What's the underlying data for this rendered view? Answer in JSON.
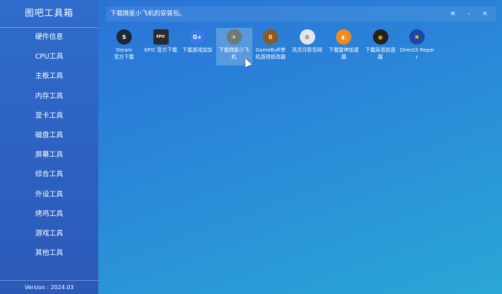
{
  "sidebar": {
    "title": "图吧工具箱",
    "items": [
      {
        "label": "硬件信息"
      },
      {
        "label": "CPU工具"
      },
      {
        "label": "主板工具"
      },
      {
        "label": "内存工具"
      },
      {
        "label": "显卡工具"
      },
      {
        "label": "磁盘工具"
      },
      {
        "label": "屏幕工具"
      },
      {
        "label": "综合工具"
      },
      {
        "label": "外设工具"
      },
      {
        "label": "烤鸡工具"
      },
      {
        "label": "游戏工具"
      },
      {
        "label": "其他工具"
      }
    ],
    "version": "Version : 2024.03"
  },
  "header": {
    "title": "下载微星小飞机的安装包。",
    "menu_glyph": "≡",
    "minimize_glyph": "-",
    "close_glyph": "×"
  },
  "tiles": [
    {
      "label": "Steam\n官方下载",
      "icon": "steam-icon",
      "glyph": "S",
      "bg": "#1b2838",
      "fg": "#ffffff"
    },
    {
      "label": "EPIC 官方下载",
      "icon": "epic-icon",
      "glyph": "EPIC",
      "bg": "#2b2b2b",
      "fg": "#ffffff"
    },
    {
      "label": "下载游戏加加",
      "icon": "gamejiajia-icon",
      "glyph": "G+",
      "bg": "#3a7be8",
      "fg": "#ffffff"
    },
    {
      "label": "下载微星小飞机",
      "icon": "afterburner-icon",
      "glyph": "✈",
      "bg": "#6e7b74",
      "fg": "#e8f4ea"
    },
    {
      "label": "GameBuff单机游戏修改器",
      "icon": "gamebuff-icon",
      "glyph": "B",
      "bg": "#8a5a2b",
      "fg": "#ffd08a"
    },
    {
      "label": "风灵月影官网",
      "icon": "fengling-icon",
      "glyph": "⚙",
      "bg": "#e6e6e6",
      "fg": "#555555"
    },
    {
      "label": "下载雷神加速器",
      "icon": "leishen-icon",
      "glyph": "◐",
      "bg": "#f08a1c",
      "fg": "#ffffff"
    },
    {
      "label": "下载奇游加速器",
      "icon": "qiyou-icon",
      "glyph": "◉",
      "bg": "#222222",
      "fg": "#f5c400"
    },
    {
      "label": "DirectX Repair",
      "icon": "directx-icon",
      "glyph": "✖",
      "bg": "#1a47a8",
      "fg": "#f5d400"
    }
  ],
  "active_tile": 3
}
